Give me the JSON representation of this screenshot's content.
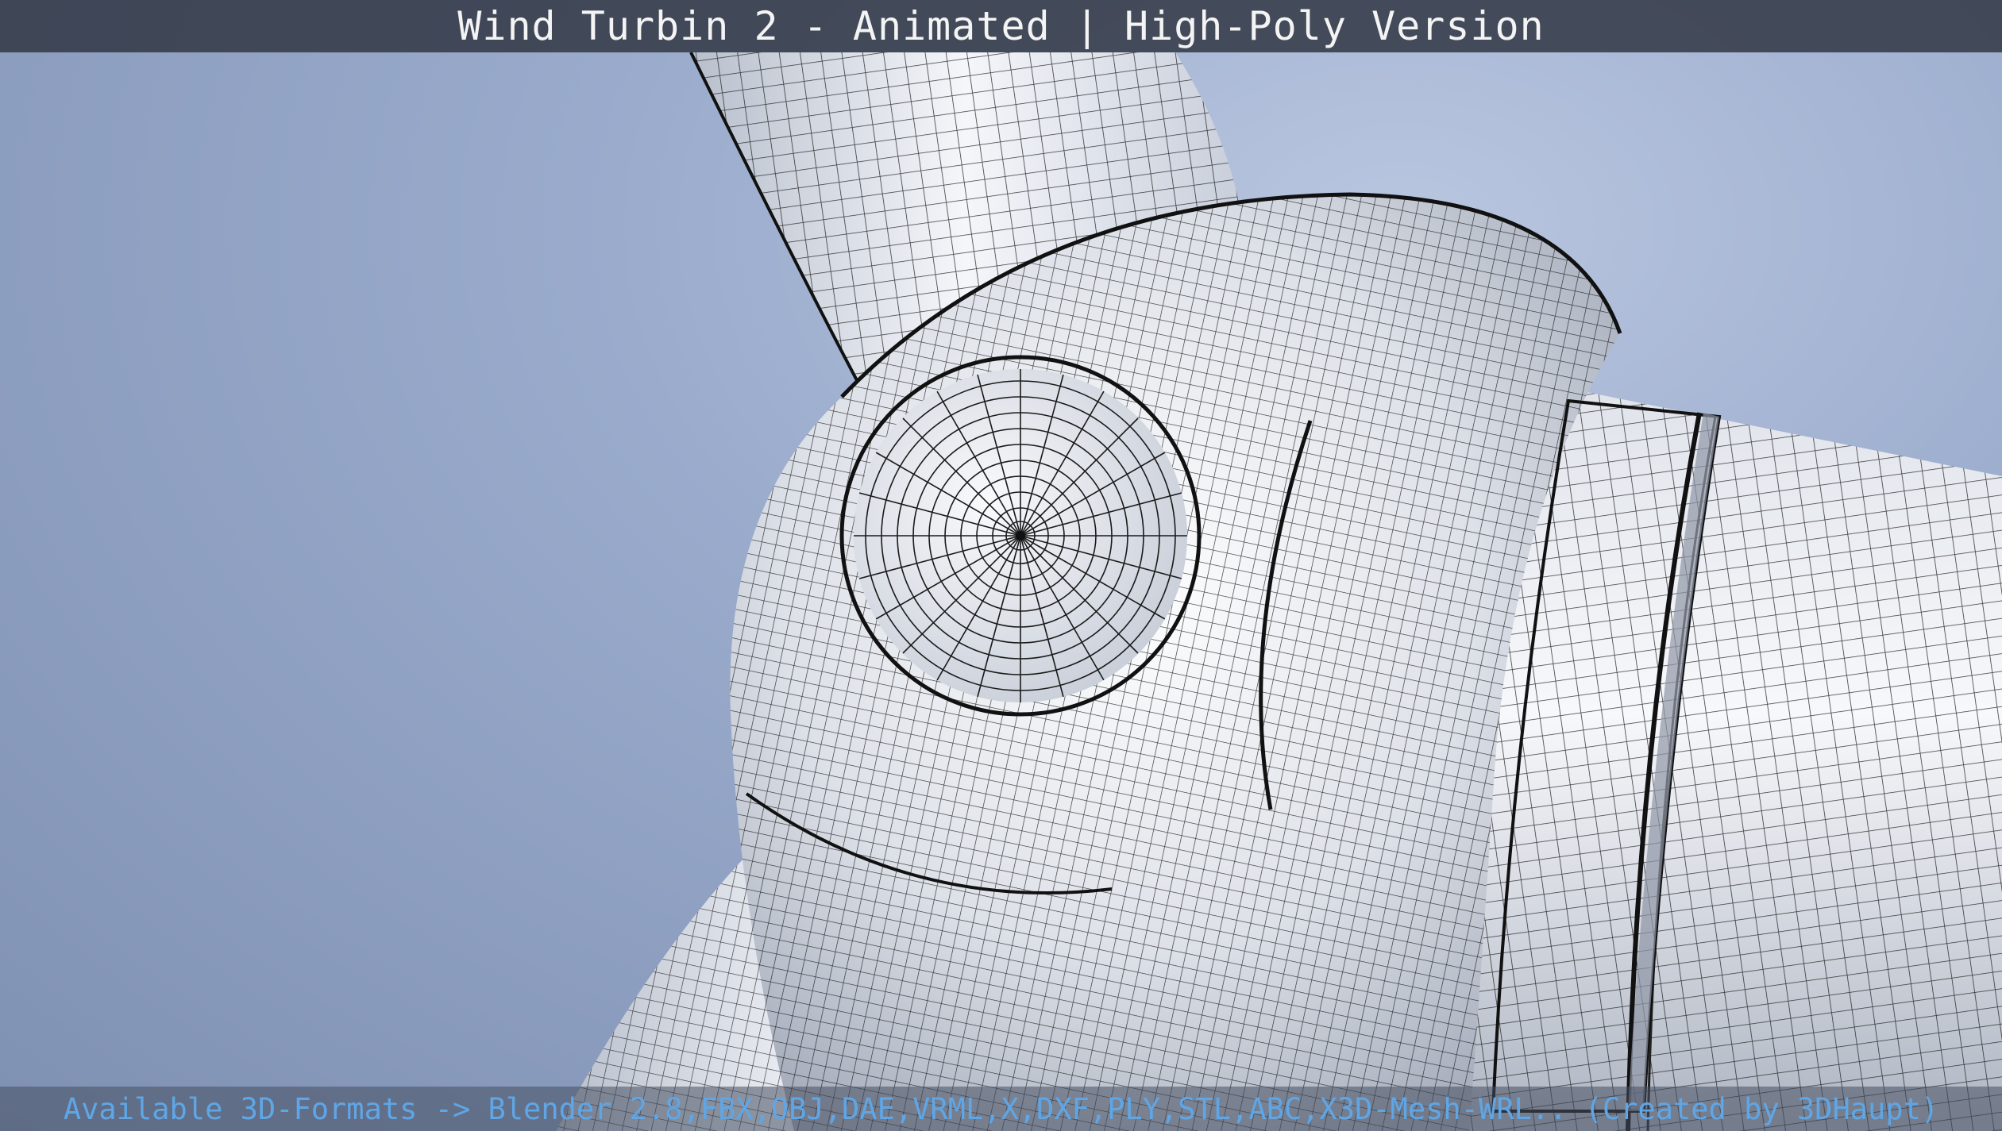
{
  "title": "Wind Turbin 2 - Animated | High-Poly Version",
  "footer": "Available 3D-Formats -> Blender 2.8,FBX,OBJ,DAE,VRML,X,DXF,PLY,STL,ABC,X3D-Mesh-WRL.. (Created by 3DHaupt)",
  "colors": {
    "sky": "#9aabcc",
    "mesh_surface": "#e9ecf2",
    "wire": "#1a1a1a",
    "title_bg": "#343a48",
    "footer_text": "#5fa6e6"
  }
}
